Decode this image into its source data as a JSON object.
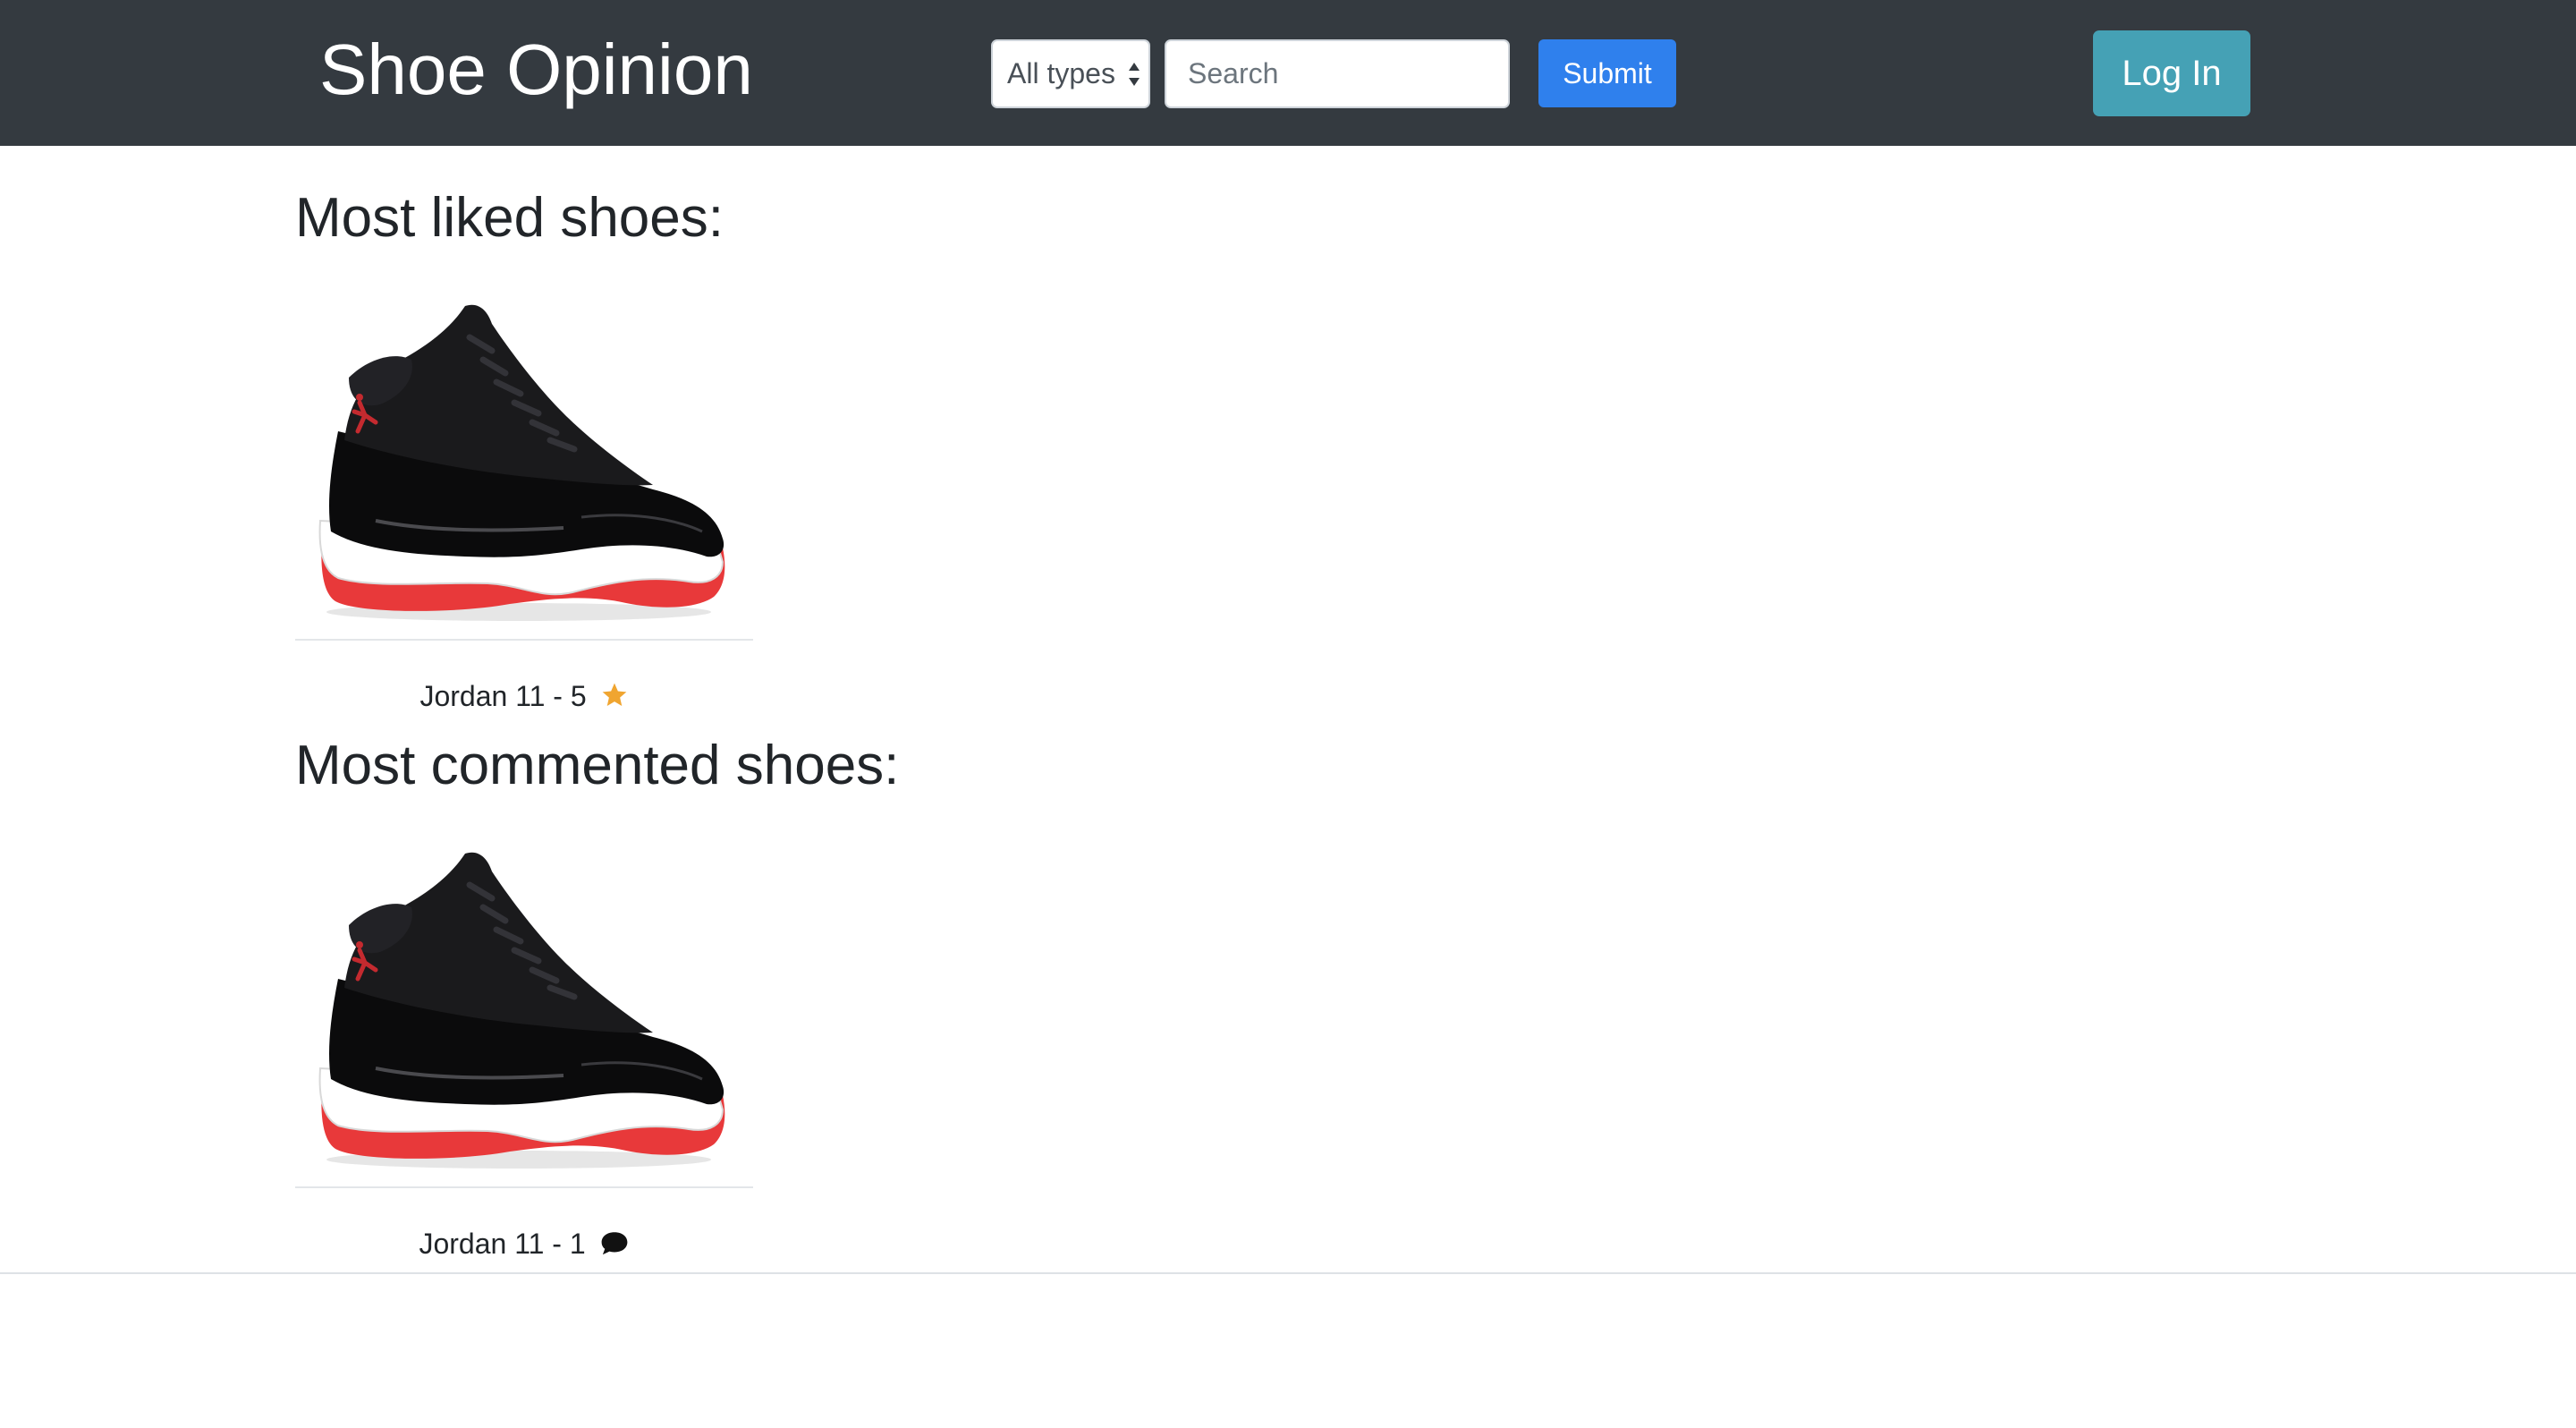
{
  "navbar": {
    "brand": "Shoe Opinion",
    "type_select": {
      "selected": "All types"
    },
    "search": {
      "placeholder": "Search",
      "value": ""
    },
    "submit_label": "Submit",
    "login_label": "Log In"
  },
  "sections": {
    "most_liked": {
      "title": "Most liked shoes:",
      "items": [
        {
          "name": "Jordan 11",
          "separator": " - ",
          "count": "5",
          "icon": "star-icon"
        }
      ]
    },
    "most_commented": {
      "title": "Most commented shoes:",
      "items": [
        {
          "name": "Jordan 11",
          "separator": " - ",
          "count": "1",
          "icon": "comment-icon"
        }
      ]
    }
  },
  "colors": {
    "navbar_bg": "#343a40",
    "submit_bg": "#2f80ed",
    "login_bg": "#45a1b5",
    "star": "#f0a530"
  }
}
